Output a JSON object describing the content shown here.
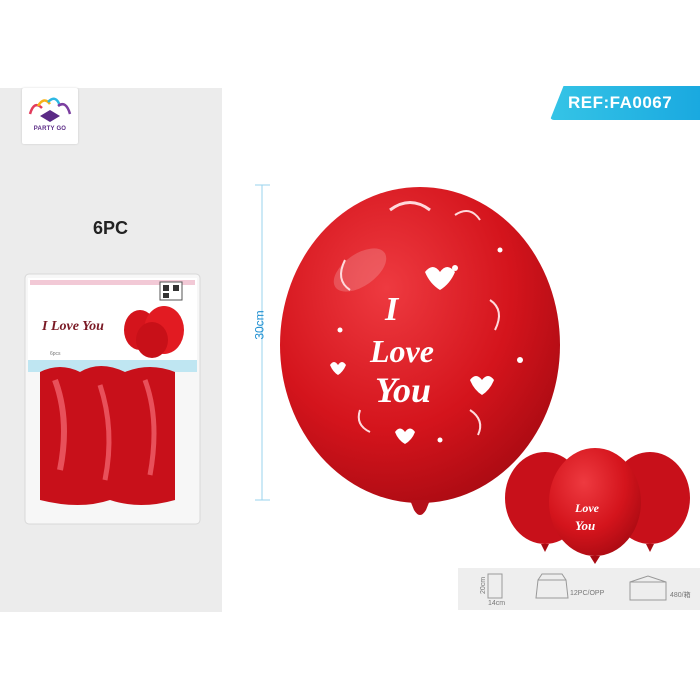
{
  "brand": {
    "name": "PARTY GO"
  },
  "product": {
    "count": "6PC",
    "ref": "REF:FA0067",
    "size": "30cm",
    "package_title": "I Love You",
    "package_count": "6pcs",
    "balloon_print_line1": "I",
    "balloon_print_line2": "Love",
    "balloon_print_line3": "You"
  },
  "specs": {
    "bag_height": "20cm",
    "bag_width": "14cm",
    "per_opp": "12PC/OPP",
    "per_carton": "480/箱"
  },
  "colors": {
    "balloon_red": "#d4141c",
    "accent_blue": "#2db8e4"
  }
}
